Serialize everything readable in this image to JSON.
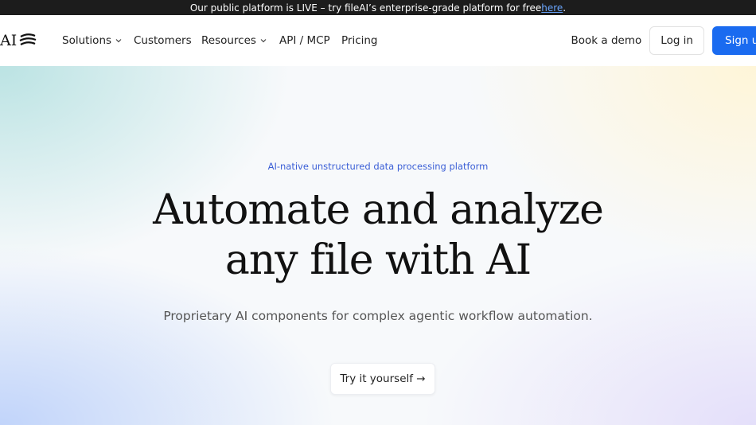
{
  "announcement": {
    "text": "Our public platform is LIVE – try fileAI’s enterprise-grade platform for free ",
    "link": "here",
    "suffix": "."
  },
  "nav": {
    "logo_text": "AI",
    "items": [
      {
        "label": "Solutions",
        "has_dropdown": true
      },
      {
        "label": "Customers",
        "has_dropdown": false
      },
      {
        "label": "Resources",
        "has_dropdown": true
      },
      {
        "label": "API / MCP",
        "has_dropdown": false
      },
      {
        "label": "Pricing",
        "has_dropdown": false
      }
    ],
    "book_demo": "Book a demo",
    "login": "Log in",
    "signup": "Sign up"
  },
  "hero": {
    "eyebrow": "AI-native unstructured data processing platform",
    "headline_line1": "Automate and analyze",
    "headline_line2": "any file with AI",
    "subheadline": "Proprietary AI components for complex agentic workflow automation.",
    "cta": "Try it yourself →"
  },
  "colors": {
    "primary": "#1a6bf0",
    "announcement_bg": "#1c1c1c",
    "eyebrow": "#3b5fd6",
    "link": "#6aa6ff"
  },
  "icons": [
    "logo-mark-icon",
    "chevron-down-icon"
  ]
}
